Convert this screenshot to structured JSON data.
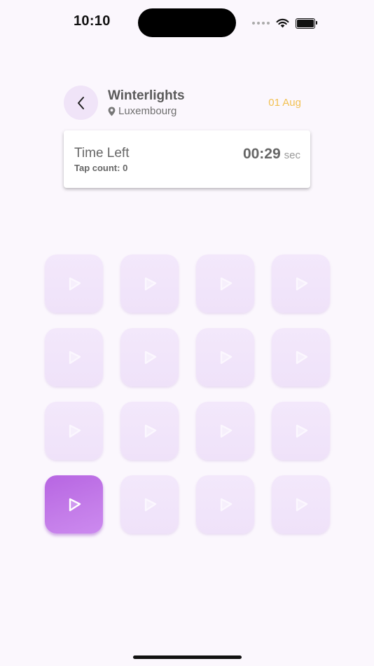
{
  "status_bar": {
    "time": "10:10"
  },
  "header": {
    "title": "Winterlights",
    "location": "Luxembourg",
    "date": "01 Aug"
  },
  "timer": {
    "label": "Time Left",
    "tap_count": "Tap count: 0",
    "value": "00:29",
    "unit": "sec"
  },
  "grid": {
    "rows": 4,
    "columns": 4,
    "active_tile_row": 4,
    "active_tile_column": 1
  },
  "colors": {
    "background": "#fbf7fd",
    "accent": "#c47de9",
    "date": "#f2c153",
    "tile_inactive": "#f1e5fa"
  },
  "icons": {
    "back": "chevron-left-icon",
    "location": "location-pin-icon",
    "tile": "play-icon"
  }
}
